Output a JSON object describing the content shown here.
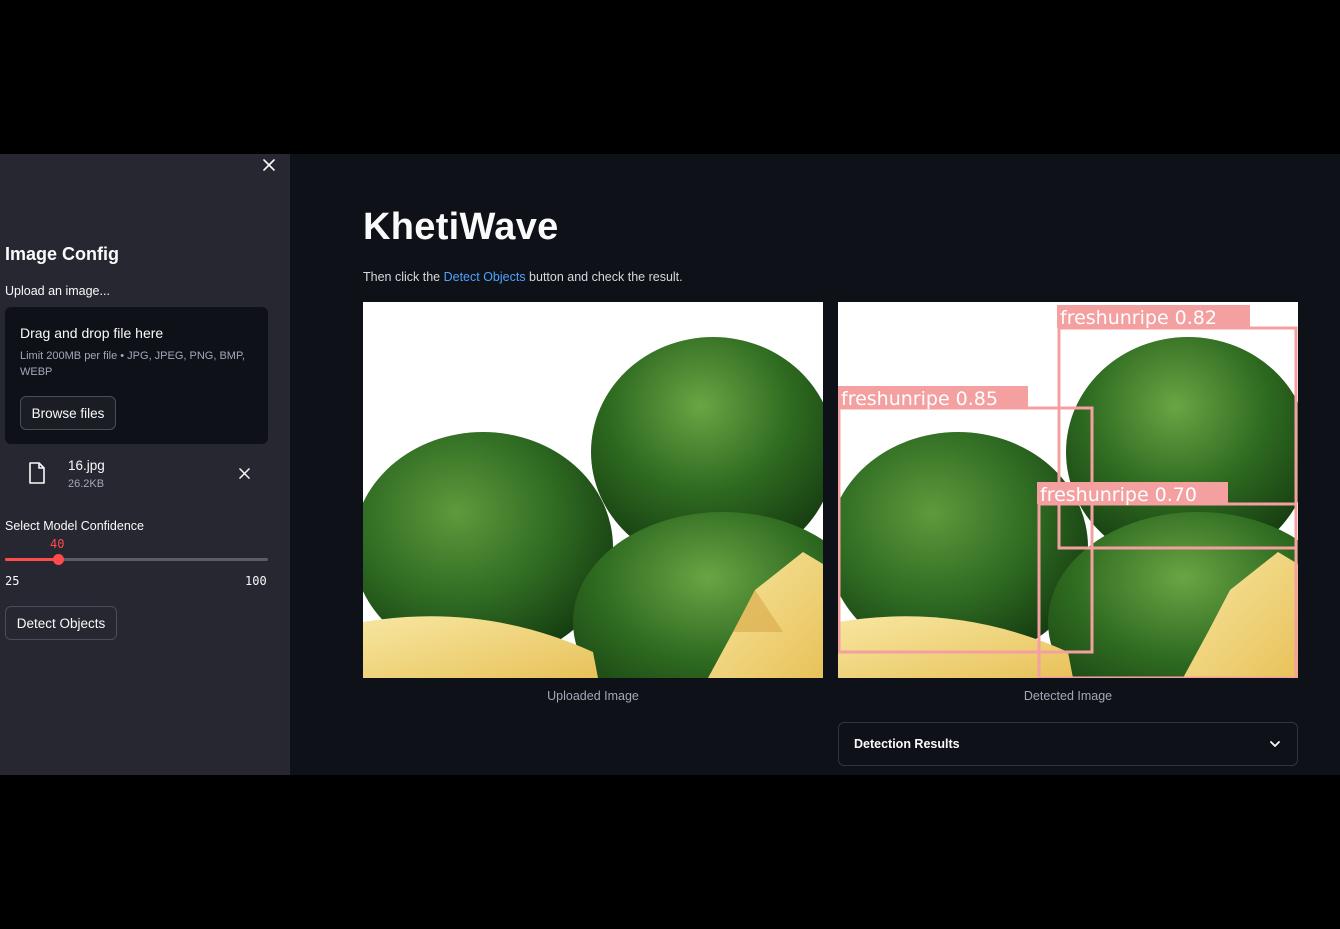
{
  "sidebar": {
    "title": "Image Config",
    "upload_label": "Upload an image...",
    "dropzone": {
      "title": "Drag and drop file here",
      "subtitle": "Limit 200MB per file • JPG, JPEG, PNG, BMP, WEBP",
      "browse_label": "Browse files"
    },
    "file": {
      "name": "16.jpg",
      "size": "26.2KB"
    },
    "slider": {
      "label": "Select Model Confidence",
      "value": 40,
      "value_text": "40",
      "min": 25,
      "max": 100,
      "min_text": "25",
      "max_text": "100"
    },
    "detect_label": "Detect Objects"
  },
  "main": {
    "title": "KhetiWave",
    "instruction_prefix": "Then click the ",
    "instruction_link": "Detect Objects",
    "instruction_suffix": " button and check the result.",
    "uploaded_caption": "Uploaded Image",
    "detected_caption": "Detected Image",
    "detections": [
      {
        "label": "freshunripe 0.82"
      },
      {
        "label": "freshunripe 0.85"
      },
      {
        "label": "freshunripe 0.70"
      }
    ],
    "results_label": "Detection Results"
  },
  "colors": {
    "accent": "#ff4b4b",
    "link": "#4da3ff",
    "box": "#f4a0a0",
    "sidebar_bg": "#262730",
    "main_bg": "#0e1117"
  }
}
